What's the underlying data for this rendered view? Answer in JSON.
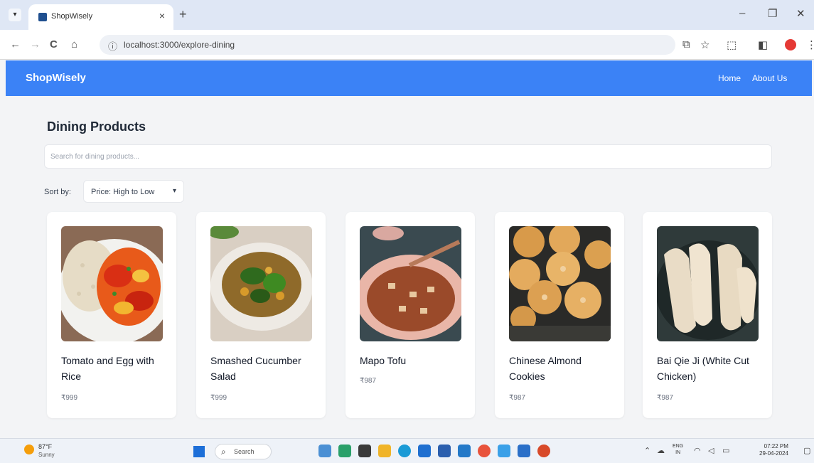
{
  "browser": {
    "tab_title": "ShopWisely",
    "tab_close_glyph": "×",
    "new_tab_glyph": "+",
    "url": "localhost:3000/explore-dining",
    "window_controls": {
      "minimize": "–",
      "restore": "❐",
      "close": "✕"
    },
    "nav_glyphs": {
      "back": "←",
      "forward": "→",
      "reload": "C",
      "home": "⌂"
    },
    "toolbar_glyphs": {
      "translate": "⧉",
      "star": "☆",
      "extensions": "⬚",
      "side_panel": "◧"
    }
  },
  "app": {
    "brand": "ShopWisely",
    "nav_links": [
      "Home",
      "About Us"
    ],
    "accent_color": "#3b82f6"
  },
  "page": {
    "title": "Dining Products",
    "search_placeholder": "Search for dining products...",
    "sort_label": "Sort by:",
    "sort_selected": "Price: High to Low"
  },
  "products": [
    {
      "name": "Tomato and Egg with Rice",
      "price": "₹999",
      "image": "tomato-egg-rice-photo"
    },
    {
      "name": "Smashed Cucumber Salad",
      "price": "₹999",
      "image": "cucumber-salad-photo"
    },
    {
      "name": "Mapo Tofu",
      "price": "₹987",
      "image": "mapo-tofu-photo"
    },
    {
      "name": "Chinese Almond Cookies",
      "price": "₹987",
      "image": "almond-cookies-photo"
    },
    {
      "name": "Bai Qie Ji (White Cut Chicken)",
      "price": "₹987",
      "image": "white-cut-chicken-photo"
    }
  ],
  "taskbar": {
    "weather_temp": "87°F",
    "weather_desc": "Sunny",
    "search_label": "Search",
    "lang_line1": "ENG",
    "lang_line2": "IN",
    "time": "07:22 PM",
    "date": "29-04-2024"
  }
}
